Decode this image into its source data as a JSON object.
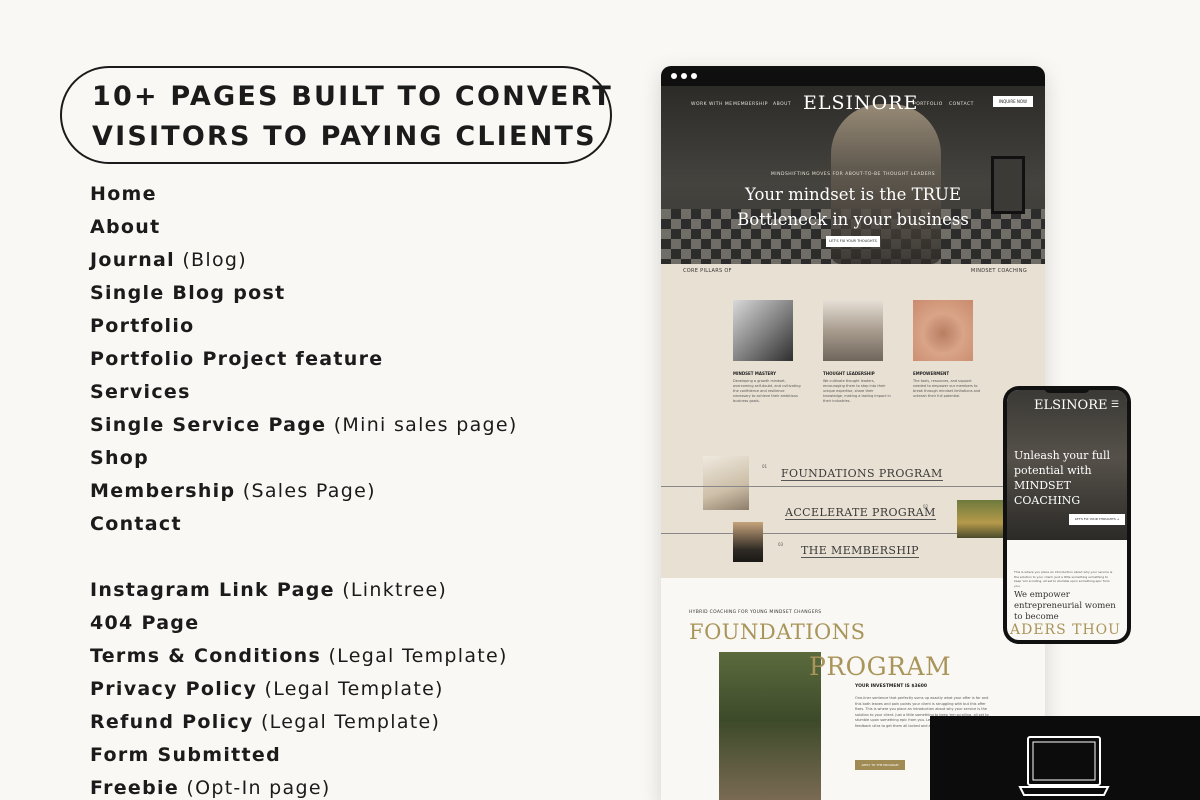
{
  "heading": {
    "line1": "10+ PAGES BUILT TO CONVERT",
    "line2": "VISITORS TO PAYING CLIENTS"
  },
  "pages": [
    {
      "name": "Home",
      "note": ""
    },
    {
      "name": "About",
      "note": ""
    },
    {
      "name": "Journal",
      "note": "(Blog)"
    },
    {
      "name": "Single Blog post",
      "note": ""
    },
    {
      "name": "Portfolio",
      "note": ""
    },
    {
      "name": "Portfolio Project feature",
      "note": ""
    },
    {
      "name": "Services",
      "note": ""
    },
    {
      "name": "Single Service Page",
      "note": "(Mini sales page)"
    },
    {
      "name": "Shop",
      "note": ""
    },
    {
      "name": "Membership",
      "note": "(Sales Page)"
    },
    {
      "name": "Contact",
      "note": ""
    }
  ],
  "extra_pages": [
    {
      "name": "Instagram Link Page",
      "note": "(Linktree)"
    },
    {
      "name": "404 Page",
      "note": ""
    },
    {
      "name": "Terms & Conditions",
      "note": "(Legal Template)"
    },
    {
      "name": "Privacy Policy",
      "note": "(Legal Template)"
    },
    {
      "name": "Refund Policy",
      "note": "(Legal Template)"
    },
    {
      "name": "Form Submitted",
      "note": ""
    },
    {
      "name": "Freebie",
      "note": "(Opt-In page)"
    }
  ],
  "desktop": {
    "nav": {
      "work": "WORK WITH ME",
      "membership": "MEMBERSHIP",
      "about": "ABOUT",
      "portfolio": "PORTFOLIO",
      "contact": "CONTACT",
      "button": "INQUIRE NOW"
    },
    "logo": "ELSINORE",
    "hero": {
      "kicker": "MINDSHIFTING MOVES FOR ABOUT-TO-BE THOUGHT LEADERS",
      "title_line1": "Your mindset is the TRUE",
      "title_line2": "Bottleneck in your business",
      "cta": "LET'S FIX YOUR THOUGHTS"
    },
    "pillars": {
      "left_label": "CORE PILLARS OF",
      "right_label": "MINDSET COACHING",
      "items": [
        {
          "title": "MINDSET MASTERY",
          "text": "Developing a growth mindset, overcoming self-doubt, and cultivating the confidence and resilience necessary to achieve their ambitious business goals."
        },
        {
          "title": "THOUGHT LEADERSHIP",
          "text": "We cultivate thought leaders, encouraging them to step into their unique expertise, share their knowledge, making a lasting impact in their industries."
        },
        {
          "title": "EMPOWERMENT",
          "text": "The tools, resources, and support needed to empower our members to break through mindset limitations and unleash their full potential."
        }
      ]
    },
    "programs": [
      {
        "num": "01",
        "name": "FOUNDATIONS PROGRAM"
      },
      {
        "num": "02",
        "name": "ACCELERATE PROGRAM"
      },
      {
        "num": "03",
        "name": "THE MEMBERSHIP"
      }
    ],
    "foundations": {
      "kicker": "HYBRID COACHING FOR YOUNG MINDSET CHANGERS",
      "title1": "FOUNDATIONS",
      "title2": "PROGRAM",
      "investment": "YOUR INVESTMENT IS $3600",
      "text": "One-liner sentence that perfectly sums up exactly what your offer is for and this both leaves and pain points your client is struggling with but this offer fixes. This is where you place an introduction about why your service is the solution to your client. Just a little something to keep 'em scrolling, all set to stumble upon something epic from you. Let's close out the circle, it's feedback ultra to get them all locked and alerted.",
      "button": "APPLY TO THE PROGRAM"
    }
  },
  "mobile": {
    "logo": "ELSINORE",
    "title": "Unleash your full potential with MINDSET COACHING",
    "cta": "LET'S FIX YOUR THOUGHTS →",
    "text": "This is where you place an introduction about why your service is the solution to your client. Just a little something something to keep 'em scrolling, all set to stumble upon something epic from you.",
    "empower": "We empower entrepreneurial women to become",
    "marquee": "ADERS THOU"
  },
  "colors": {
    "gold": "#a9955a",
    "beige": "#e8e0d2",
    "background": "#faf8f4",
    "ink": "#1b1b1b"
  }
}
